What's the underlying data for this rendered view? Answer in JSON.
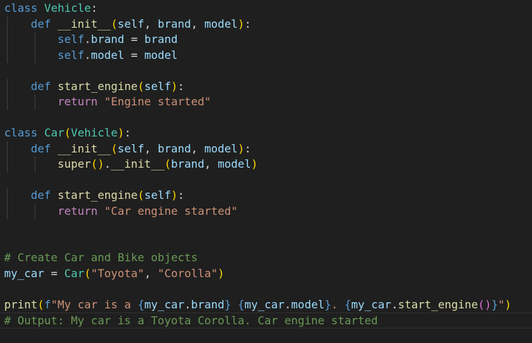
{
  "editor": {
    "lines": [
      [
        [
          "kw",
          "class"
        ],
        [
          "pl",
          " "
        ],
        [
          "cls",
          "Vehicle"
        ],
        [
          "pn",
          ":"
        ]
      ],
      [
        [
          "pl",
          "    "
        ],
        [
          "kw",
          "def"
        ],
        [
          "pl",
          " "
        ],
        [
          "fn",
          "__init__"
        ],
        [
          "b1",
          "("
        ],
        [
          "pa",
          "self"
        ],
        [
          "pn",
          ", "
        ],
        [
          "pa",
          "brand"
        ],
        [
          "pn",
          ", "
        ],
        [
          "pa",
          "model"
        ],
        [
          "b1",
          ")"
        ],
        [
          "pn",
          ":"
        ]
      ],
      [
        [
          "pl",
          "        "
        ],
        [
          "kw",
          "self"
        ],
        [
          "pn",
          "."
        ],
        [
          "pa",
          "brand"
        ],
        [
          "pl",
          " = "
        ],
        [
          "pa",
          "brand"
        ]
      ],
      [
        [
          "pl",
          "        "
        ],
        [
          "kw",
          "self"
        ],
        [
          "pn",
          "."
        ],
        [
          "pa",
          "model"
        ],
        [
          "pl",
          " = "
        ],
        [
          "pa",
          "model"
        ]
      ],
      [],
      [
        [
          "pl",
          "    "
        ],
        [
          "kw",
          "def"
        ],
        [
          "pl",
          " "
        ],
        [
          "fn",
          "start_engine"
        ],
        [
          "b1",
          "("
        ],
        [
          "pa",
          "self"
        ],
        [
          "b1",
          ")"
        ],
        [
          "pn",
          ":"
        ]
      ],
      [
        [
          "pl",
          "        "
        ],
        [
          "ctl",
          "return"
        ],
        [
          "pl",
          " "
        ],
        [
          "str",
          "\"Engine started\""
        ]
      ],
      [],
      [
        [
          "kw",
          "class"
        ],
        [
          "pl",
          " "
        ],
        [
          "cls",
          "Car"
        ],
        [
          "b1",
          "("
        ],
        [
          "cls",
          "Vehicle"
        ],
        [
          "b1",
          ")"
        ],
        [
          "pn",
          ":"
        ]
      ],
      [
        [
          "pl",
          "    "
        ],
        [
          "kw",
          "def"
        ],
        [
          "pl",
          " "
        ],
        [
          "fn",
          "__init__"
        ],
        [
          "b1",
          "("
        ],
        [
          "pa",
          "self"
        ],
        [
          "pn",
          ", "
        ],
        [
          "pa",
          "brand"
        ],
        [
          "pn",
          ", "
        ],
        [
          "pa",
          "model"
        ],
        [
          "b1",
          ")"
        ],
        [
          "pn",
          ":"
        ]
      ],
      [
        [
          "pl",
          "        "
        ],
        [
          "fn",
          "super"
        ],
        [
          "b1",
          "()"
        ],
        [
          "pn",
          "."
        ],
        [
          "fn",
          "__init__"
        ],
        [
          "b1",
          "("
        ],
        [
          "pa",
          "brand"
        ],
        [
          "pn",
          ", "
        ],
        [
          "pa",
          "model"
        ],
        [
          "b1",
          ")"
        ]
      ],
      [],
      [
        [
          "pl",
          "    "
        ],
        [
          "kw",
          "def"
        ],
        [
          "pl",
          " "
        ],
        [
          "fn",
          "start_engine"
        ],
        [
          "b1",
          "("
        ],
        [
          "pa",
          "self"
        ],
        [
          "b1",
          ")"
        ],
        [
          "pn",
          ":"
        ]
      ],
      [
        [
          "pl",
          "        "
        ],
        [
          "ctl",
          "return"
        ],
        [
          "pl",
          " "
        ],
        [
          "str",
          "\"Car engine started\""
        ]
      ],
      [],
      [],
      [
        [
          "cm",
          "# Create Car and Bike objects"
        ]
      ],
      [
        [
          "pa",
          "my_car"
        ],
        [
          "pl",
          " = "
        ],
        [
          "cls",
          "Car"
        ],
        [
          "b1",
          "("
        ],
        [
          "str",
          "\"Toyota\""
        ],
        [
          "pn",
          ", "
        ],
        [
          "str",
          "\"Corolla\""
        ],
        [
          "b1",
          ")"
        ]
      ],
      [],
      [
        [
          "fn",
          "print"
        ],
        [
          "b1",
          "("
        ],
        [
          "kw",
          "f"
        ],
        [
          "str",
          "\"My car is a "
        ],
        [
          "kw",
          "{"
        ],
        [
          "pa",
          "my_car"
        ],
        [
          "pn",
          "."
        ],
        [
          "pa",
          "brand"
        ],
        [
          "kw",
          "}"
        ],
        [
          "str",
          " "
        ],
        [
          "kw",
          "{"
        ],
        [
          "pa",
          "my_car"
        ],
        [
          "pn",
          "."
        ],
        [
          "pa",
          "model"
        ],
        [
          "kw",
          "}"
        ],
        [
          "str",
          ". "
        ],
        [
          "kw",
          "{"
        ],
        [
          "pa",
          "my_car"
        ],
        [
          "pn",
          "."
        ],
        [
          "fn",
          "start_engine"
        ],
        [
          "b2",
          "()"
        ],
        [
          "kw",
          "}"
        ],
        [
          "str",
          "\""
        ],
        [
          "b1",
          ")"
        ]
      ],
      [
        [
          "cm",
          "# Output: My car is a Toyota Corolla. Car engine started"
        ]
      ]
    ]
  },
  "colors": {
    "background": "#1f1f1f",
    "keyword": "#569cd6",
    "class": "#4ec9b0",
    "function": "#dcdcaa",
    "param": "#9cdcfe",
    "control": "#c586c0",
    "string": "#ce9178",
    "comment": "#6a9955",
    "plain": "#d4d4d4",
    "bracket1": "#ffd700",
    "bracket2": "#da70d6"
  }
}
